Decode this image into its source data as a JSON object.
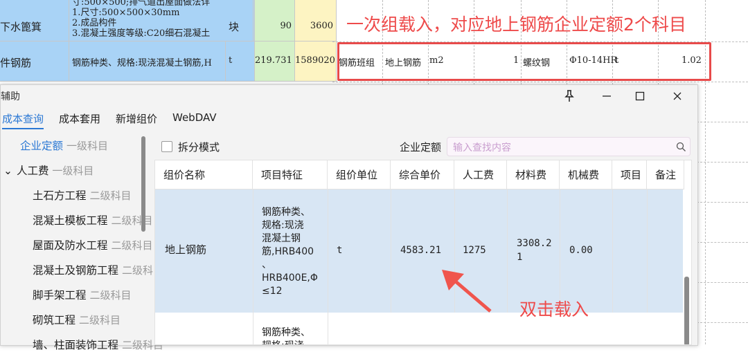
{
  "sheet": {
    "row1": {
      "name": "下水篦箕",
      "feature_lines": [
        "寸:500×500;排气道出屋面做法详",
        "1.尺寸:500×500×30mm",
        "2.成品构件",
        "3.混凝土强度等级:C20细石混凝土"
      ],
      "unit": "块",
      "qty": "90",
      "amount": "3600"
    },
    "row2": {
      "name": "件钢筋",
      "feature": "钢筋种类、规格:现浇混凝土钢筋,H",
      "unit": "t",
      "qty": "219.731",
      "amount": "1589020",
      "c1": "钢筋班组",
      "c2": "地上钢筋",
      "c3": "m2",
      "c4": "1",
      "c5": "螺纹钢",
      "c6": "Φ10-14HR",
      "c7": "t",
      "c8": "1.02"
    }
  },
  "annotations": {
    "top": "一次组载入，对应地上钢筋企业定额2个科目",
    "bottom": "双击载入"
  },
  "dialog": {
    "title": "辅助",
    "menu": [
      "成本查询",
      "成本套用",
      "新增组价",
      "WebDAV"
    ],
    "split_mode_label": "拆分模式",
    "quota_label": "企业定额",
    "search_placeholder": "输入查找内容",
    "tree": [
      {
        "name": "企业定额",
        "level": "一级科目"
      },
      {
        "name": "人工费",
        "level": "一级科目"
      },
      {
        "name": "土石方工程",
        "level": "二级科目"
      },
      {
        "name": "混凝土模板工程",
        "level": "二级科目"
      },
      {
        "name": "屋面及防水工程",
        "level": "二级科目"
      },
      {
        "name": "混凝土及钢筋工程",
        "level": "二级科目"
      },
      {
        "name": "脚手架工程",
        "level": "二级科目"
      },
      {
        "name": "砌筑工程",
        "level": "二级科目"
      },
      {
        "name": "墙、柱面装饰工程",
        "level": "二级科目"
      }
    ],
    "columns": [
      "组价名称",
      "项目特征",
      "组价单位",
      "综合单价",
      "人工费",
      "材料费",
      "机械费",
      "项目",
      "备注"
    ],
    "rows": [
      {
        "name": "地上钢筋",
        "feature_lines": [
          "钢筋种类、",
          "规格:现浇",
          "混凝土钢",
          "筋,HRB400",
          "、",
          "HRB400E,Φ",
          "≤12"
        ],
        "unit": "t",
        "price": "4583.21",
        "labor": "1275",
        "material_lines": [
          "3308.2",
          "1"
        ],
        "machine": "0.00"
      },
      {
        "feature_lines": [
          "钢筋种类、",
          "规格:现浇"
        ]
      }
    ]
  }
}
